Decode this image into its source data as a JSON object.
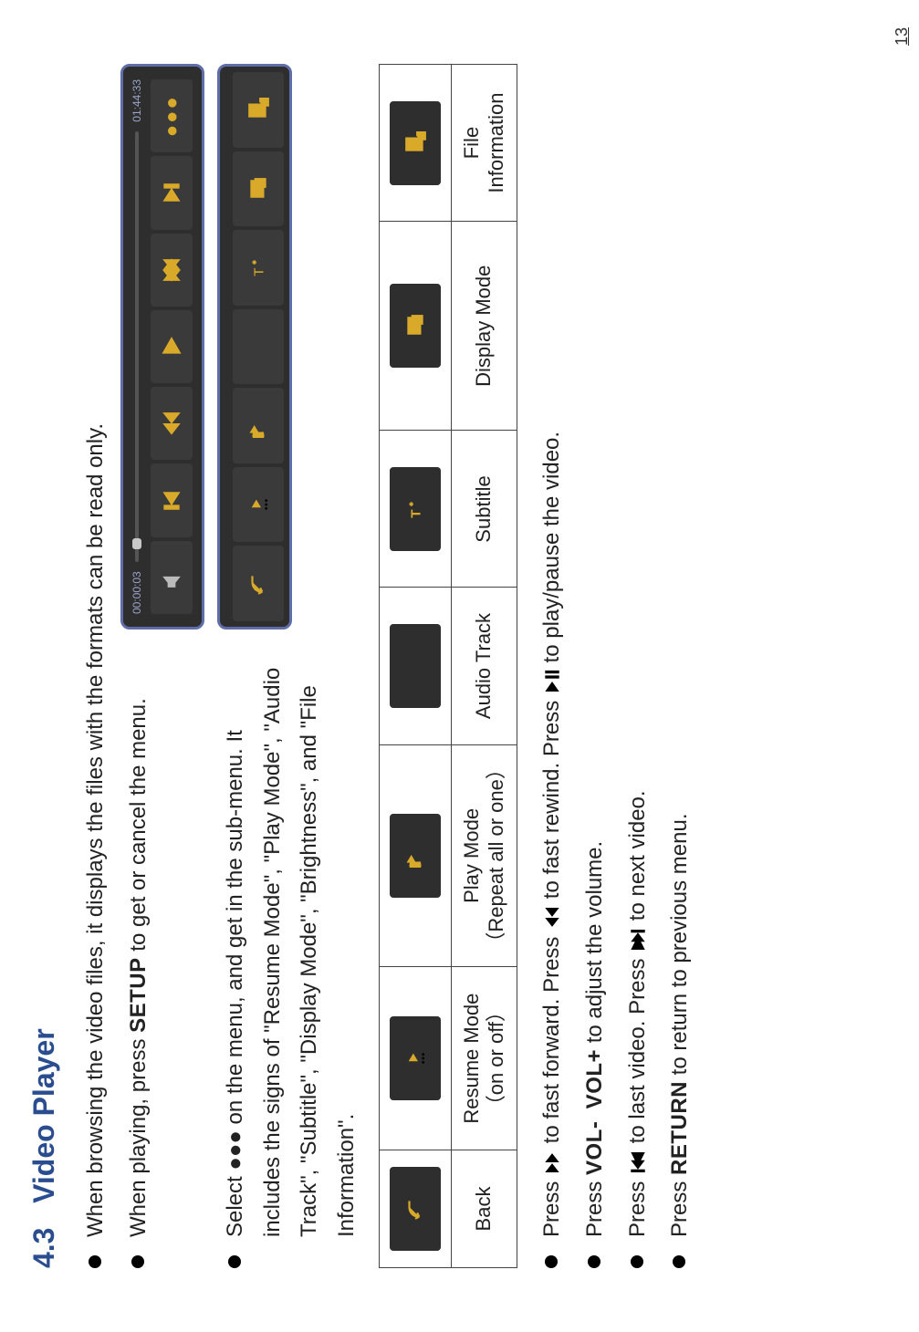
{
  "section": {
    "number": "4.3",
    "title": "Video Player"
  },
  "bullets": {
    "b1": "When browsing the video files, it displays the files with the formats can be read only.",
    "b2_pre": "When playing, press ",
    "b2_kw": "SETUP",
    "b2_post": " to get or cancel the menu.",
    "b3a": "Select ●●● on the menu, and get in the sub-menu. It",
    "b3b": "includes the signs of \"Resume Mode\", \"Play Mode\", \"Audio",
    "b3c": "Track\", \"Subtitle\", \"Display Mode\", \"Brightness\", and \"File",
    "b3d": "Information\"."
  },
  "player": {
    "time_start": "00:00:03",
    "time_end": "01:44:33"
  },
  "table": {
    "headers": {
      "back": "Back",
      "resume": "Resume Mode",
      "resume_sub": "（on or off）",
      "play": "Play Mode",
      "play_sub": "（Repeat all or one）",
      "audio": "Audio Track",
      "subtitle": "Subtitle",
      "display": "Display Mode",
      "file": "File",
      "file_sub": "Information"
    }
  },
  "actions": {
    "a1_pre": "Press ",
    "a1_mid": " to fast forward. Press ",
    "a1_mid2": " to fast rewind. Press ",
    "a1_post": " to play/pause the video.",
    "a2_pre": "Press ",
    "a2_kw1": "VOL-",
    "a2_kw2": "VOL+",
    "a2_post": " to adjust the volume.",
    "a3_pre": "Press ",
    "a3_mid": " to last video. Press ",
    "a3_post": " to next video.",
    "a4_pre": "Press ",
    "a4_kw": "RETURN",
    "a4_post": " to return to previous menu."
  },
  "page_number": "13"
}
